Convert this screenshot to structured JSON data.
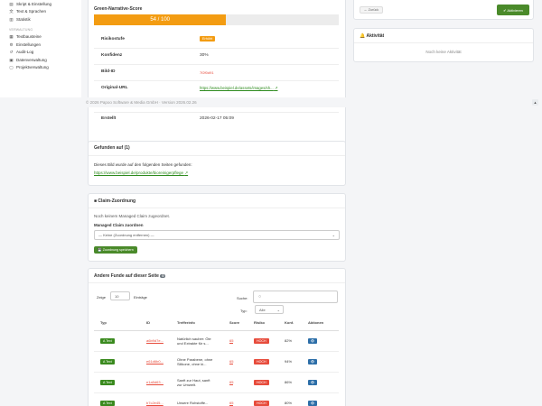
{
  "sidebar": {
    "items_top": [
      {
        "label": "Skript & Einstellung",
        "icon": "script-icon"
      },
      {
        "label": "Text & Sprachen",
        "icon": "translate-icon"
      },
      {
        "label": "Statistik",
        "icon": "chart-icon"
      }
    ],
    "section_label": "VERWALTUNG",
    "items_admin": [
      {
        "label": "Textbausteine",
        "icon": "text-blocks-icon"
      },
      {
        "label": "Einstellungen",
        "icon": "gear-icon"
      },
      {
        "label": "Audit-Log",
        "icon": "log-icon"
      },
      {
        "label": "Datenverwaltung",
        "icon": "database-icon"
      },
      {
        "label": "Projektverwaltung",
        "icon": "project-icon"
      }
    ]
  },
  "footer": {
    "copyright": "© 2026 Papoo Software & Media GmbH · Version 2026.02.26",
    "toggle_icon": "triangle-icon",
    "toggle_glyph": "▲"
  },
  "score_card": {
    "title": "Green-Narrative-Score",
    "progress_label": "54 / 100",
    "progress_value": 0.54,
    "rows": [
      {
        "label": "Risikostufe",
        "value": "Erhöht",
        "kind": "badge"
      },
      {
        "label": "Konfidenz",
        "value": "30%",
        "kind": "text"
      },
      {
        "label": "Bild-ID",
        "value": "7f2f0d91",
        "kind": "pink"
      },
      {
        "label": "Original-URL",
        "value": "https://www.beispiel.de/assets/images/sh...",
        "kind": "link"
      },
      {
        "label": "Erstellt",
        "value": "2026-02-17 05:09",
        "kind": "text"
      }
    ]
  },
  "right_top": {
    "back_button": "← Zurück",
    "activate_button": "✔ Aktivieren"
  },
  "activity": {
    "title": "Aktivität",
    "icon": "bell-icon",
    "empty": "Noch keine Aktivität"
  },
  "found_on": {
    "title": "Gefunden auf (1)",
    "intro": "Dieses Bild wurde auf den folgenden Seiten gefunden:",
    "link": "https://www.beispiel.de/produkte/bioreinigerpflege"
  },
  "claim": {
    "title": "Claim-Zuordnung",
    "icon": "bookmark-icon",
    "none_text": "Noch keinem Managed Claim zugeordnet.",
    "assign_label": "Managed Claim zuordnen",
    "select_value": "— Keine (Zuordnung entfernen) —",
    "save_button": "💾 Zuordnung speichern"
  },
  "other_finds": {
    "title": "Andere Funde auf dieser Seite",
    "count": "0",
    "show_label": "Zeige",
    "show_value": "10",
    "entries_label": "Einträge",
    "search_label": "Suche:",
    "type_label": "Typ:",
    "type_value": "Alle",
    "columns": [
      "Typ",
      "ID",
      "Trefferinfo",
      "Score",
      "Risiko",
      "Konf.",
      "Aktionen"
    ],
    "rows": [
      {
        "type": "A Text",
        "id": "a6b9d7e...",
        "info": [
          "Natürlich sauber: Öle",
          "und Extrakte für s..."
        ],
        "score": "65",
        "risk": "HOCH",
        "conf": "82%",
        "action": "👁"
      },
      {
        "type": "A Text",
        "id": "e61d6b0...",
        "info": [
          "Ohne Parabene, ohne",
          "Silikone, ohne ki..."
        ],
        "score": "65",
        "risk": "HOCH",
        "conf": "94%",
        "action": "👁"
      },
      {
        "type": "A Text",
        "id": "e1a5d63...",
        "info": [
          "Sanft zur Haut, sanft",
          "zur Umwelt."
        ],
        "score": "65",
        "risk": "HOCH",
        "conf": "86%",
        "action": "👁"
      },
      {
        "type": "A Text",
        "id": "b7c2e45...",
        "info": [
          "Unsere Rohstoffe...",
          ""
        ],
        "score": "65",
        "risk": "HOCH",
        "conf": "80%",
        "action": "👁"
      }
    ]
  },
  "colors": {
    "accent_orange": "#f39c12",
    "accent_green": "#4a8a2a",
    "risk_red": "#e74c3c",
    "action_blue": "#2c6ea8"
  }
}
